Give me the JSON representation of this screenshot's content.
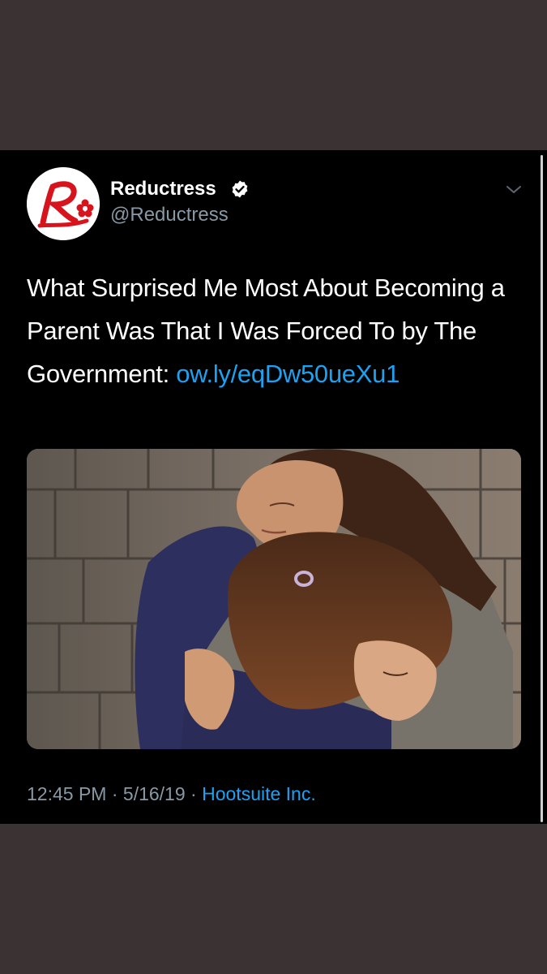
{
  "tweet": {
    "display_name": "Reductress",
    "handle": "@Reductress",
    "text": "What Surprised Me Most About Becoming a Parent Was That I Was Forced To by The Government: ",
    "link_text": "ow.ly/eqDw50ueXu1",
    "time": "12:45 PM",
    "separator": " · ",
    "date": "5/16/19",
    "source": "Hootsuite Inc.",
    "avatar_icon": "reductress-logo",
    "verified_icon": "verified-badge-icon",
    "menu_icon": "chevron-down-icon",
    "media_description": "photo"
  },
  "colors": {
    "background_outer": "#3b3233",
    "card": "#000000",
    "text_primary": "#ffffff",
    "text_secondary": "#8899a6",
    "link": "#1da1f2",
    "brand_red": "#d7141e"
  }
}
